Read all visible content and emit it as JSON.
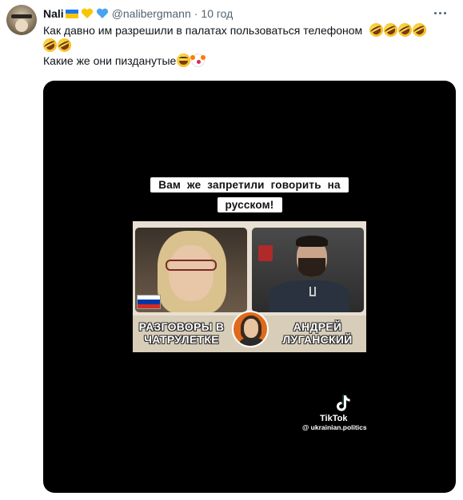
{
  "author": {
    "display_name": "Nali",
    "handle": "@nalibergmann",
    "separator": "·",
    "time": "10 год",
    "badges": [
      "ukraine-flag-icon",
      "yellow-heart-icon",
      "blue-heart-icon"
    ]
  },
  "tweet": {
    "line1": "Как давно им разрешили в палатах пользоваться телефоном",
    "line1_emojis": [
      "rofl-icon",
      "rofl-icon",
      "rofl-icon",
      "rofl-icon"
    ],
    "line2_emojis": [
      "rofl-icon",
      "rofl-icon"
    ],
    "line3": "Какие же они пизданутые",
    "line3_emojis": [
      "grinning-squinting-icon",
      "clown-icon"
    ]
  },
  "video": {
    "caption_line1": "Вам же запретили говорить на",
    "caption_line2": "русском!",
    "banner_left": "РАЗГОВОРЫ В ЧАТРУЛЕТКЕ",
    "banner_right": "АНДРЕЙ ЛУГАНСКИЙ",
    "watermark_brand": "TikTok",
    "watermark_handle": "@ ukrainian.politics"
  },
  "colors": {
    "text_primary": "#0f1419",
    "text_secondary": "#536471",
    "media_bg": "#000000",
    "ua_blue": "#1877f2",
    "ua_yellow": "#f7c600"
  }
}
